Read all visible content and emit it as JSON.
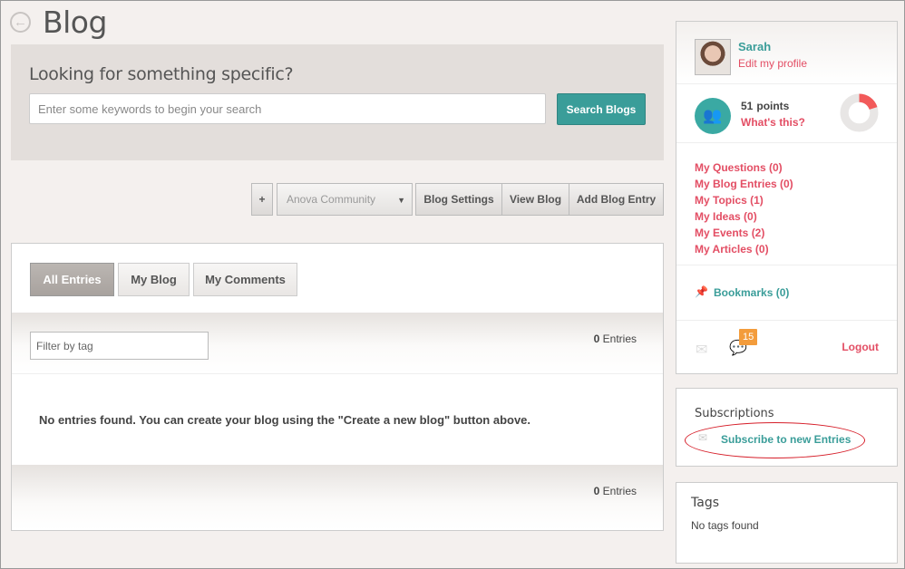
{
  "header": {
    "back_icon": "back-arrow-icon",
    "title": "Blog"
  },
  "search": {
    "heading": "Looking for something specific?",
    "placeholder": "Enter some keywords to begin your search",
    "value": "",
    "button_label": "Search Blogs"
  },
  "toolbar": {
    "plus_label": "+",
    "community_selected": "Anova Community",
    "blog_settings_label": "Blog Settings",
    "view_blog_label": "View Blog",
    "add_entry_label": "Add Blog Entry"
  },
  "entries": {
    "tabs": [
      {
        "label": "All Entries",
        "active": true
      },
      {
        "label": "My Blog",
        "active": false
      },
      {
        "label": "My Comments",
        "active": false
      }
    ],
    "filter_placeholder": "Filter by tag",
    "count_value": "0",
    "count_label": "Entries",
    "empty_message": "No entries found. You can create your blog using the \"Create a new blog\" button above."
  },
  "profile": {
    "name": "Sarah",
    "edit_label": "Edit my profile",
    "points_value": "51",
    "points_label": "points",
    "whats_this": "What's this?",
    "points_progress_fraction": 0.2,
    "links": [
      "My Questions (0)",
      "My Blog Entries (0)",
      "My Topics (1)",
      "My Ideas (0)",
      "My Events (2)",
      "My Articles (0)"
    ],
    "bookmarks": "Bookmarks (0)",
    "notification_count": "15",
    "logout": "Logout"
  },
  "subscriptions": {
    "heading": "Subscriptions",
    "subscribe_label": "Subscribe to new Entries"
  },
  "tags": {
    "heading": "Tags",
    "empty": "No tags found"
  },
  "colors": {
    "accent_teal": "#3a9d99",
    "link_pink": "#e34e64",
    "badge_orange": "#f39c3c",
    "highlight_red": "#d61f2a"
  }
}
